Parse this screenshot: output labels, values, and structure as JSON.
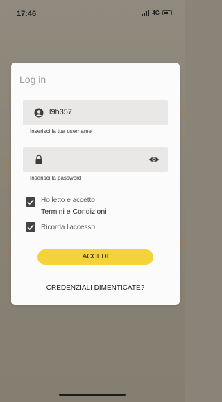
{
  "status_bar": {
    "time": "17:46",
    "network": "4G"
  },
  "login_card": {
    "title": "Log in",
    "username": {
      "value": "l9h357",
      "hint": "Inserisci la tua username",
      "icon": "user-circle-icon"
    },
    "password": {
      "value": "",
      "hint": "Inserisci la password",
      "icon": "lock-icon",
      "toggle_icon": "eye-icon"
    },
    "terms_checkbox": {
      "checked": true,
      "label_line1": "Ho letto e accetto",
      "label_line2": "Termini e Condizioni"
    },
    "remember_checkbox": {
      "checked": true,
      "label": "Ricorda l'accesso"
    },
    "login_button": "ACCEDI",
    "forgot_link": "CREDENZIALI DIMENTICATE?"
  },
  "colors": {
    "background": "#8a8478",
    "card": "#fbfbfb",
    "field": "#e9e8e6",
    "accent": "#f4d23a",
    "checkbox": "#444444"
  }
}
